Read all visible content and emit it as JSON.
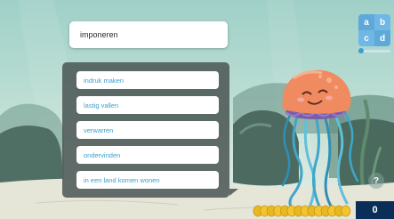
{
  "question": {
    "word": "imponeren"
  },
  "options": [
    {
      "label": "indruk maken"
    },
    {
      "label": "lastig vallen"
    },
    {
      "label": "verwarren"
    },
    {
      "label": "ondervinden"
    },
    {
      "label": "in een land komen wonen"
    }
  ],
  "answer_mode": {
    "letters": [
      "a",
      "b",
      "c",
      "d"
    ]
  },
  "help": {
    "label": "?"
  },
  "score": {
    "value": "0"
  },
  "progress": {
    "fraction": 0.05
  },
  "colors": {
    "option_text": "#3b9fd0",
    "score_bg": "#0b2e58",
    "panel_bg": "#4a5654",
    "accent_blue": "#5fa9da"
  }
}
